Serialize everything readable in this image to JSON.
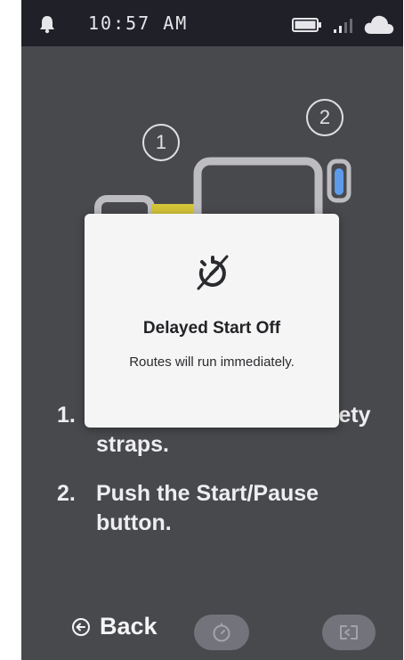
{
  "status_bar": {
    "time": "10:57 AM",
    "icons": [
      "bell-icon",
      "battery-icon",
      "signal-icon",
      "cloud-icon"
    ]
  },
  "illustration": {
    "step_markers": [
      "1",
      "2"
    ],
    "colors": {
      "outline": "#a9a9b0",
      "yellow_part": "#c8b400",
      "blue_part": "#2f7fe6"
    }
  },
  "instructions": {
    "steps": [
      {
        "index": "1.",
        "text": "Secure the vacuum safety straps."
      },
      {
        "index": "2.",
        "text": "Push the Start/Pause button."
      }
    ]
  },
  "bottom_bar": {
    "back_label": "Back",
    "icons": [
      "back-arrow-icon",
      "delay-timer-icon",
      "swap-icon"
    ]
  },
  "dialog": {
    "icon": "delay-off-icon",
    "title": "Delayed Start Off",
    "message": "Routes will run immediately."
  }
}
